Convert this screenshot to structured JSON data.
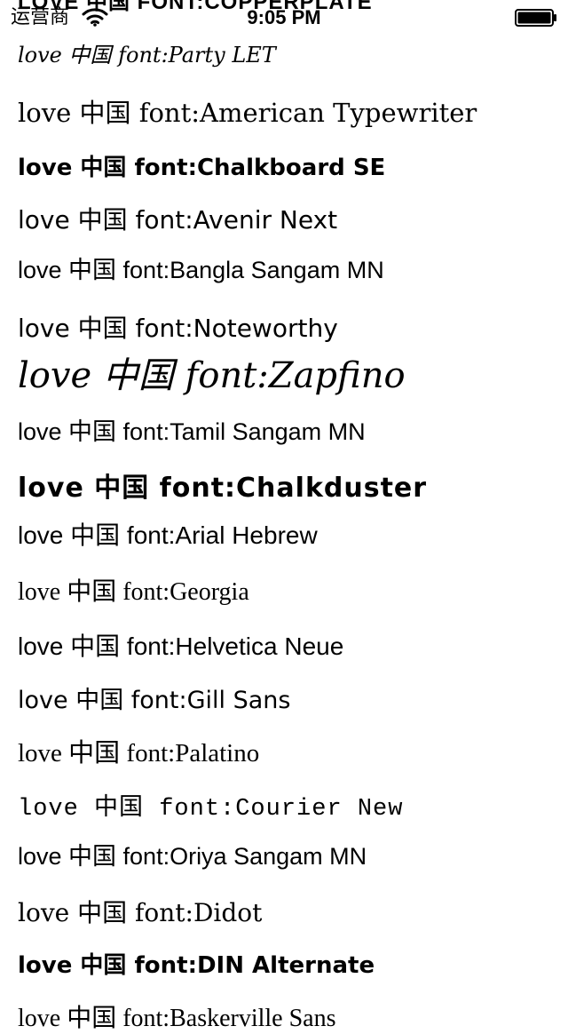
{
  "status_bar": {
    "carrier": "运营商",
    "time": "9:05 PM",
    "wifi_icon": "wifi-icon",
    "battery_icon": "battery-icon"
  },
  "rows": [
    {
      "text": "LOVE 中国 FONT:COPPERPLATE"
    },
    {
      "text": "love 中国 font:Party LET"
    },
    {
      "text": "love 中国 font:American Typewriter"
    },
    {
      "text": "love 中国 font:Chalkboard SE"
    },
    {
      "text": "love 中国 font:Avenir Next"
    },
    {
      "text": "love 中国 font:Bangla Sangam MN"
    },
    {
      "text": "love 中国 font:Noteworthy"
    },
    {
      "text": "love 中国 font:Zapfino"
    },
    {
      "text": "love 中国 font:Tamil Sangam MN"
    },
    {
      "text": "love 中国 font:Chalkduster"
    },
    {
      "text": "love 中国 font:Arial Hebrew"
    },
    {
      "text": "love 中国 font:Georgia"
    },
    {
      "text": "love 中国 font:Helvetica Neue"
    },
    {
      "text": "love 中国 font:Gill Sans"
    },
    {
      "text": "love 中国 font:Palatino"
    },
    {
      "text": "love 中国 font:Courier New"
    },
    {
      "text": "love 中国 font:Oriya Sangam MN"
    },
    {
      "text": "love 中国 font:Didot"
    },
    {
      "text": "love 中国 font:DIN Alternate"
    },
    {
      "text": "love 中国 font:Baskerville Sans"
    }
  ]
}
